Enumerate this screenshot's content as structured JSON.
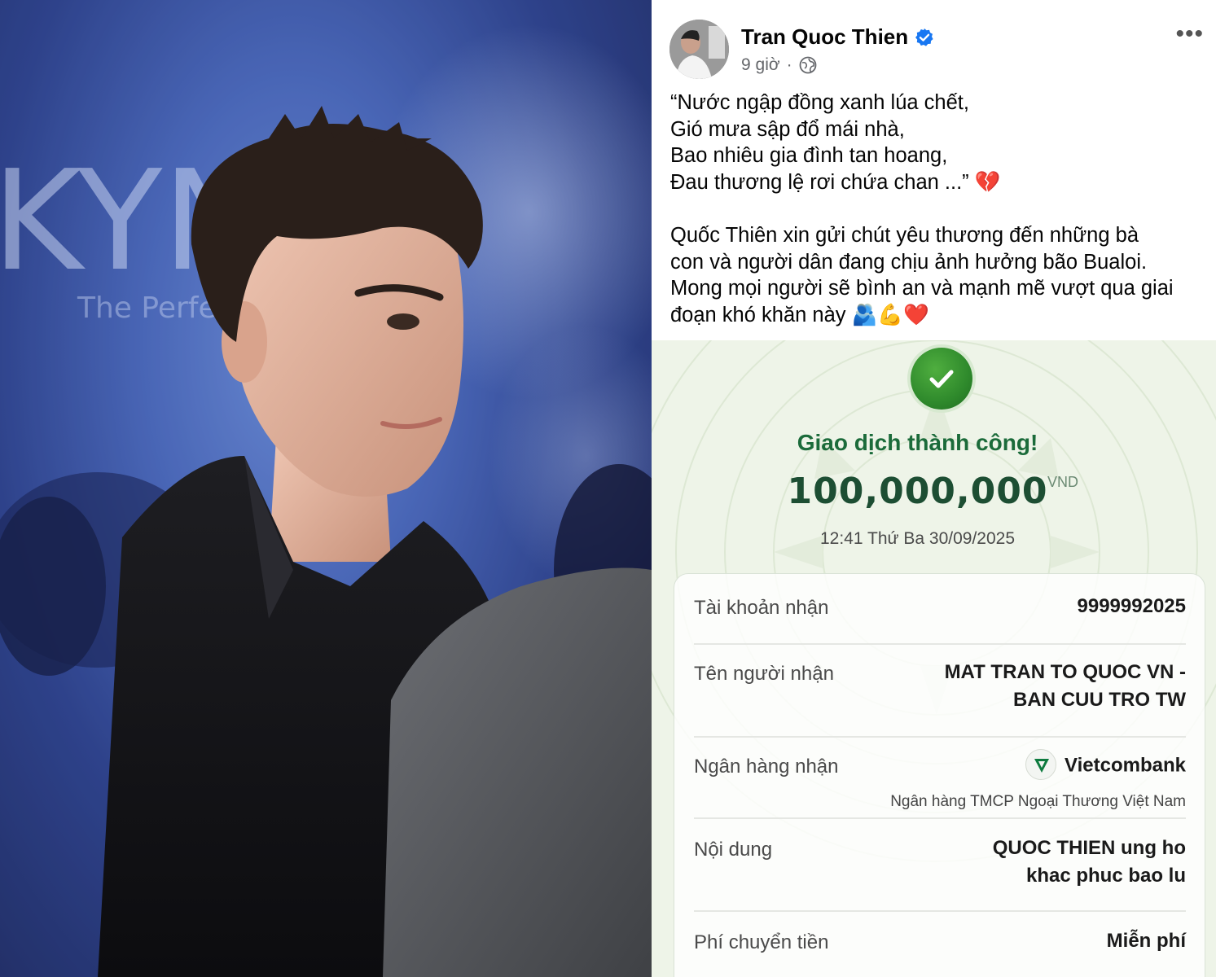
{
  "photo": {
    "backdrop_text_large": "KYNG",
    "backdrop_text_small": "The Perfect"
  },
  "post": {
    "author": "Tran Quoc Thien",
    "time": "9 giờ",
    "separator": "·",
    "privacy_icon": "globe-icon",
    "more_icon": "•••",
    "poem_lines": [
      "“Nước ngập đồng xanh lúa chết,",
      "Gió mưa sập đổ mái nhà,",
      "Bao nhiêu gia đình tan hoang,",
      "Đau thương lệ rơi chứa chan ...” 💔"
    ],
    "message_lines": [
      "Quốc Thiên xin gửi chút yêu thương đến những bà",
      "con và người dân đang chịu ảnh hưởng bão Bualoi.",
      "Mong mọi người sẽ bình an và mạnh mẽ vượt qua giai",
      "đoạn khó khăn này 🫂💪❤️"
    ]
  },
  "receipt": {
    "status": "Giao dịch thành công!",
    "amount": "100,000,000",
    "currency": "VND",
    "datetime": "12:41 Thứ Ba 30/09/2025",
    "rows": {
      "account": {
        "label": "Tài khoản nhận",
        "value": "9999992025"
      },
      "recipient": {
        "label": "Tên người nhận",
        "value_line1": "MAT TRAN TO QUOC VN -",
        "value_line2": "BAN CUU TRO TW"
      },
      "bank": {
        "label": "Ngân hàng nhận",
        "value": "Vietcombank",
        "sub": "Ngân hàng TMCP Ngoại Thương Việt Nam"
      },
      "content": {
        "label": "Nội dung",
        "value_line1": "QUOC THIEN ung ho",
        "value_line2": "khac phuc bao lu"
      },
      "fee": {
        "label": "Phí chuyển tiền",
        "value": "Miễn phí"
      }
    }
  },
  "colors": {
    "verified": "#1877f2",
    "success_green": "#1b6b3a",
    "check_green": "#2f8a2c",
    "receipt_bg": "#eef4e8"
  }
}
